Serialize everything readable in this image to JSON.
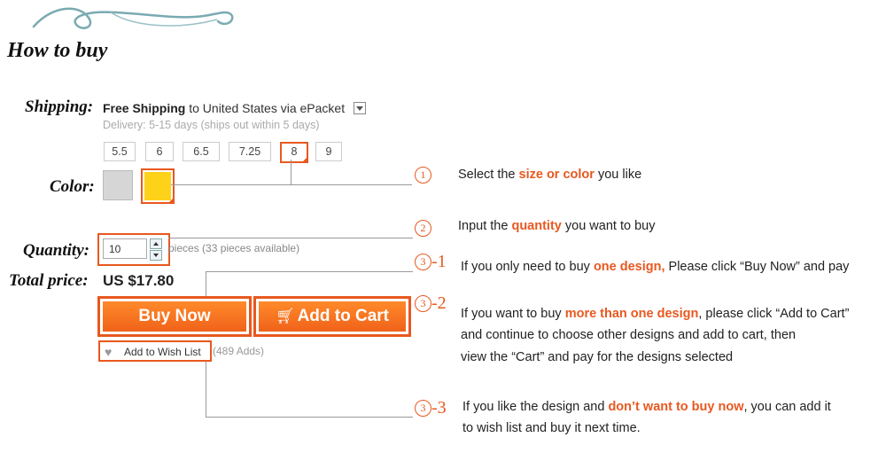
{
  "heading": "How to buy",
  "labels": {
    "shipping": "Shipping:",
    "color": "Color:",
    "quantity": "Quantity:",
    "total_price": "Total price:"
  },
  "shipping": {
    "free": "Free Shipping",
    "rest": "to United States via ePacket",
    "delivery": "Delivery: 5-15 days (ships out within 5 days)"
  },
  "sizes": [
    "5.5",
    "6",
    "6.5",
    "7.25",
    "8",
    "9"
  ],
  "selected_size": "8",
  "colors": [
    "#d6d6d6",
    "#ffd21a"
  ],
  "quantity": {
    "value": "10",
    "available": "pieces (33 pieces available)"
  },
  "total": "US $17.80",
  "buttons": {
    "buy_now": "Buy Now",
    "add_to_cart": "Add to Cart",
    "wish": "Add to Wish List",
    "wish_adds": "(489 Adds)"
  },
  "steps": {
    "s1": {
      "num": "1",
      "text_before": "Select the ",
      "highlight": "size or color",
      "text_after": " you like"
    },
    "s2": {
      "num": "2",
      "text_before": "Input the ",
      "highlight": "quantity",
      "text_after": " you want to buy"
    },
    "s3_1": {
      "num": "3",
      "suffix": "-1",
      "text_before": "If you only need to buy ",
      "highlight": "one design,",
      "text_after": "  Please click “Buy Now” and pay"
    },
    "s3_2": {
      "num": "3",
      "suffix": "-2",
      "line1_before": "If you want to buy ",
      "line1_highlight": "more than one design",
      "line1_after": ", please click “Add to Cart”",
      "line2": "and continue to choose other designs and add to cart, then",
      "line3": "view the “Cart” and pay for the designs selected"
    },
    "s3_3": {
      "num": "3",
      "suffix": "-3",
      "line1_before": "If you like the design and ",
      "line1_highlight": "don’t  want to buy now",
      "line1_after": ", you can add it",
      "line2": "to wish list and buy it next time."
    }
  }
}
